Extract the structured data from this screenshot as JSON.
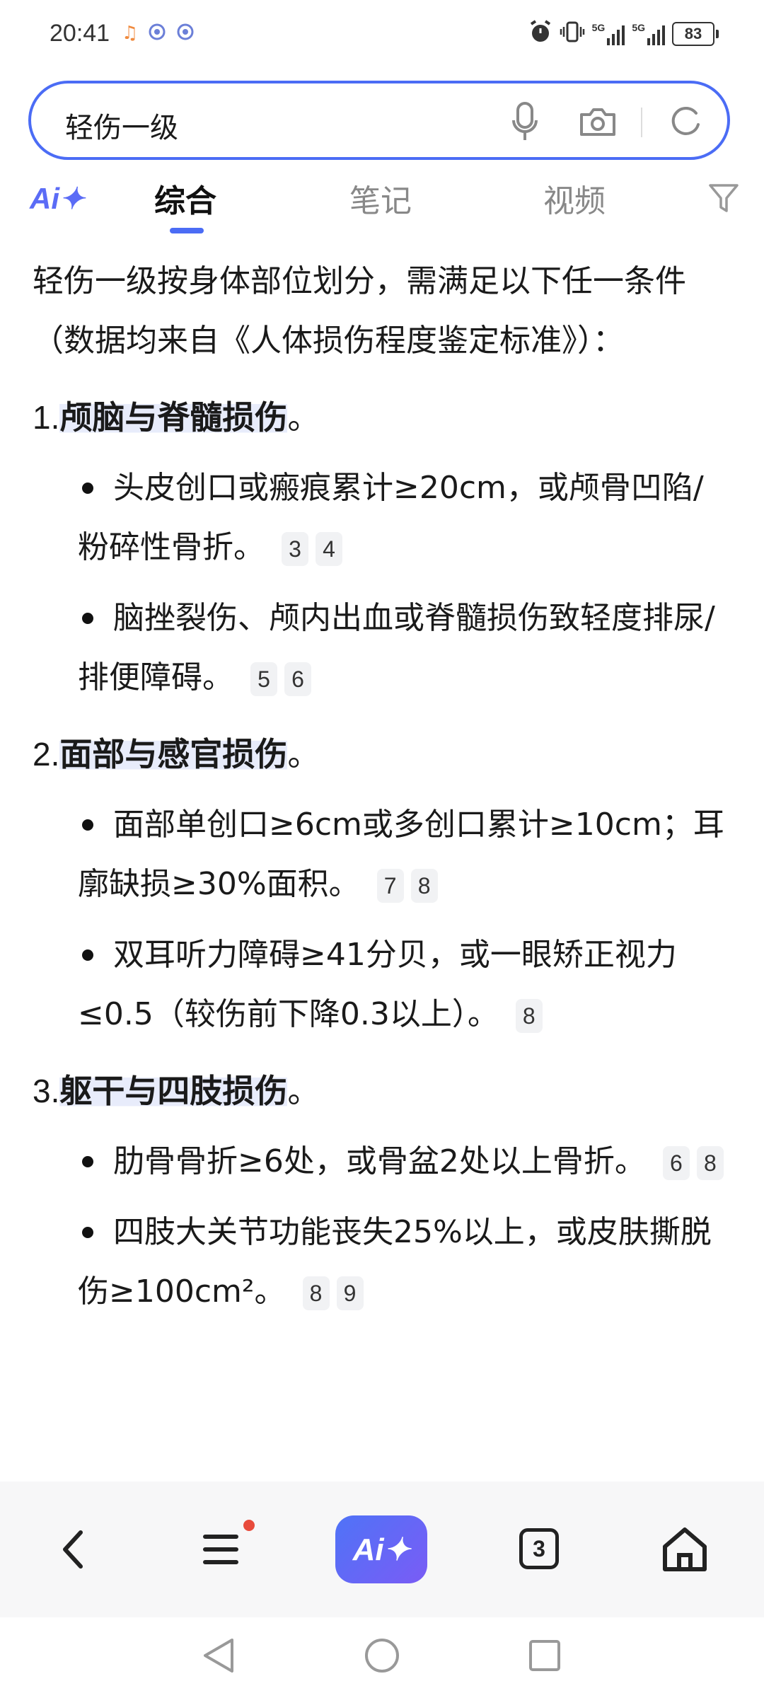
{
  "status_bar": {
    "time": "20:41",
    "signal_1": "5G",
    "signal_2": "5G",
    "battery": "83"
  },
  "search": {
    "query": "轻伤一级"
  },
  "tabs": {
    "ai_logo": "Ai✦",
    "items": [
      "综合",
      "笔记",
      "视频"
    ],
    "active": "综合"
  },
  "content": {
    "intro": "轻伤一级按身体部位划分，需满足以下任一条件（数据均来自《人体损伤程度鉴定标准》）：",
    "sections": [
      {
        "num": "1.",
        "title": "颅脑与脊髓损伤",
        "end": "。",
        "bullets": [
          {
            "text": "头皮创口或瘢痕累计≥20cm，或颅骨凹陷/粉碎性骨折。",
            "cites": [
              "3",
              "4"
            ]
          },
          {
            "text": "脑挫裂伤、颅内出血或脊髓损伤致轻度排尿/排便障碍。",
            "cites": [
              "5",
              "6"
            ]
          }
        ]
      },
      {
        "num": "2.",
        "title": "面部与感官损伤",
        "end": "。",
        "bullets": [
          {
            "text": "面部单创口≥6cm或多创口累计≥10cm；耳廓缺损≥30%面积。",
            "cites": [
              "7",
              "8"
            ]
          },
          {
            "text": "双耳听力障碍≥41分贝，或一眼矫正视力≤0.5（较伤前下降0.3以上）。",
            "cites": [
              "8"
            ]
          }
        ]
      },
      {
        "num": "3.",
        "title": "躯干与四肢损伤",
        "end": "。",
        "bullets": [
          {
            "text": "肋骨骨折≥6处，或骨盆2处以上骨折。",
            "cites": [
              "6",
              "8"
            ]
          },
          {
            "text": "四肢大关节功能丧失25%以上，或皮肤撕脱伤≥100cm²。",
            "cites": [
              "8",
              "9"
            ]
          }
        ]
      }
    ]
  },
  "bottom_nav": {
    "ai_label": "Ai✦",
    "tab_count": "3"
  },
  "icons": {
    "accent": "#4b6cf5",
    "highlight": "#e8ecfb",
    "badge": "#e84b3c"
  }
}
